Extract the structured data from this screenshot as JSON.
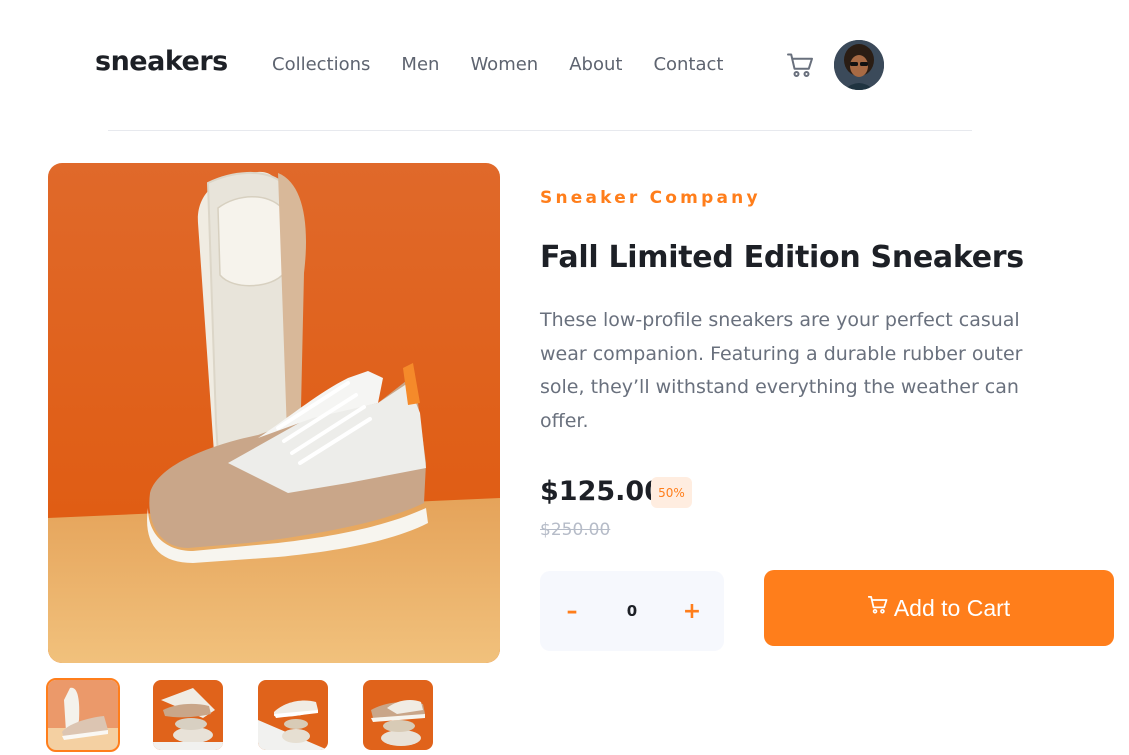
{
  "header": {
    "logo": "sneakers",
    "nav": [
      "Collections",
      "Men",
      "Women",
      "About",
      "Contact"
    ]
  },
  "product": {
    "company": "Sneaker Company",
    "title": "Fall Limited Edition Sneakers",
    "description": "These low-profile sneakers are your perfect casual wear companion. Featuring a durable rubber outer sole, they’ll withstand everything the weather can offer.",
    "price": "$125.00",
    "discount": "50%",
    "original_price": "$250.00",
    "quantity": "0",
    "minus_label": "–",
    "plus_label": "+",
    "add_to_cart_label": "Add to Cart"
  },
  "colors": {
    "accent": "#ff7e1b",
    "accent_pale": "#ffede0",
    "text_dark": "#1d2026",
    "text_gray": "#69707d"
  },
  "icons": [
    "cart-icon",
    "avatar",
    "cart-icon-button"
  ]
}
